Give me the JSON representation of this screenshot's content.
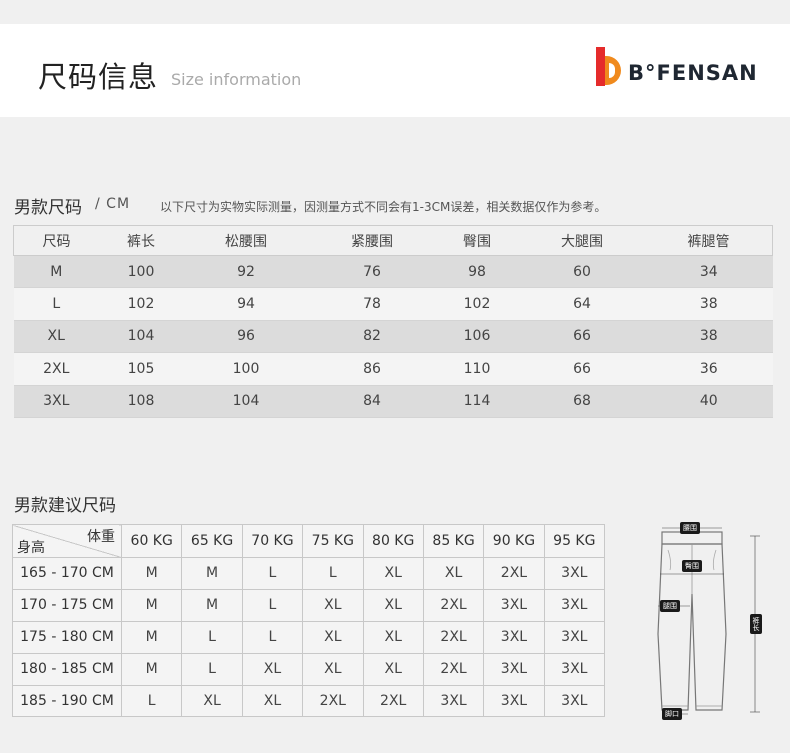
{
  "header": {
    "title": "尺码信息",
    "subtitle": "Size information",
    "brand": "B°FENSAN",
    "brand_colors": {
      "red": "#e52b2b",
      "orange": "#f08a1d",
      "text": "#1f2732"
    }
  },
  "men_size": {
    "title": "男款尺码",
    "unit": "/ CM",
    "note": "以下尺寸为实物实际测量，因测量方式不同会有1-3CM误差，相关数据仅作为参考。",
    "columns": [
      "尺码",
      "裤长",
      "松腰围",
      "紧腰围",
      "臀围",
      "大腿围",
      "裤腿管"
    ],
    "rows": [
      [
        "M",
        "100",
        "92",
        "76",
        "98",
        "60",
        "34"
      ],
      [
        "L",
        "102",
        "94",
        "78",
        "102",
        "64",
        "38"
      ],
      [
        "XL",
        "104",
        "96",
        "82",
        "106",
        "66",
        "38"
      ],
      [
        "2XL",
        "105",
        "100",
        "86",
        "110",
        "66",
        "36"
      ],
      [
        "3XL",
        "108",
        "104",
        "84",
        "114",
        "68",
        "40"
      ]
    ]
  },
  "recommend": {
    "title": "男款建议尺码",
    "corner_top": "体重",
    "corner_bottom": "身高",
    "weights": [
      "60 KG",
      "65 KG",
      "70 KG",
      "75 KG",
      "80 KG",
      "85 KG",
      "90 KG",
      "95 KG"
    ],
    "rows": [
      {
        "height": "165 - 170 CM",
        "sizes": [
          "M",
          "M",
          "L",
          "L",
          "XL",
          "XL",
          "2XL",
          "3XL"
        ]
      },
      {
        "height": "170 - 175 CM",
        "sizes": [
          "M",
          "M",
          "L",
          "XL",
          "XL",
          "2XL",
          "3XL",
          "3XL"
        ]
      },
      {
        "height": "175 - 180 CM",
        "sizes": [
          "M",
          "L",
          "L",
          "XL",
          "XL",
          "2XL",
          "3XL",
          "3XL"
        ]
      },
      {
        "height": "180 - 185 CM",
        "sizes": [
          "M",
          "L",
          "XL",
          "XL",
          "XL",
          "2XL",
          "3XL",
          "3XL"
        ]
      },
      {
        "height": "185 - 190 CM",
        "sizes": [
          "L",
          "XL",
          "XL",
          "2XL",
          "2XL",
          "3XL",
          "3XL",
          "3XL"
        ]
      }
    ]
  },
  "diagram": {
    "labels": {
      "waist": "腰围",
      "hip": "臀围",
      "thigh": "腿围",
      "length": "裤长",
      "hem": "脚口"
    }
  }
}
